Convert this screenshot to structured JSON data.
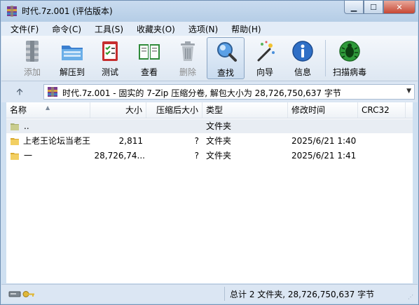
{
  "window": {
    "title": "时代.7z.001 (评估版本)",
    "controls": {
      "minimize": "▁",
      "maximize": "☐",
      "close": "✕"
    }
  },
  "menu": [
    "文件(F)",
    "命令(C)",
    "工具(S)",
    "收藏夹(O)",
    "选项(N)",
    "帮助(H)"
  ],
  "toolbar": {
    "buttons": [
      {
        "label": "添加",
        "icon": "archive-add-icon",
        "enabled": false
      },
      {
        "label": "解压到",
        "icon": "extract-folder-icon",
        "enabled": true
      },
      {
        "label": "测试",
        "icon": "test-checklist-icon",
        "enabled": true
      },
      {
        "label": "查看",
        "icon": "view-book-icon",
        "enabled": true
      },
      {
        "label": "删除",
        "icon": "trash-icon",
        "enabled": false
      },
      {
        "label": "查找",
        "icon": "magnifier-icon",
        "enabled": true,
        "active": true
      },
      {
        "label": "向导",
        "icon": "wizard-wand-icon",
        "enabled": true
      },
      {
        "label": "信息",
        "icon": "info-icon",
        "enabled": true
      },
      {
        "label": "扫描病毒",
        "icon": "virus-scan-icon",
        "enabled": true
      }
    ]
  },
  "address": {
    "up_glyph": "🡩",
    "text": "时代.7z.001 - 固实的 7-Zip 压缩分卷, 解包大小为 28,726,750,637 字节",
    "dropdown_glyph": "▼"
  },
  "columns": {
    "name": "名称",
    "size": "大小",
    "packed": "压缩后大小",
    "type": "类型",
    "modified": "修改时间",
    "crc": "CRC32"
  },
  "rows": [
    {
      "name": "..",
      "size": "",
      "packed": "",
      "type": "文件夹",
      "modified": "",
      "crc": ""
    },
    {
      "name": "上老王论坛当老王",
      "size": "2,811",
      "packed": "?",
      "type": "文件夹",
      "modified": "2025/6/21 1:40",
      "crc": ""
    },
    {
      "name": "一",
      "size": "28,726,74...",
      "packed": "?",
      "type": "文件夹",
      "modified": "2025/6/21 1:41",
      "crc": ""
    }
  ],
  "status": {
    "text": "总计 2 文件夹, 28,726,750,637 字节"
  },
  "colors": {
    "window_frame": "#cfe0f1",
    "close_button": "#c64633",
    "selected_row": "#e8edf3"
  }
}
